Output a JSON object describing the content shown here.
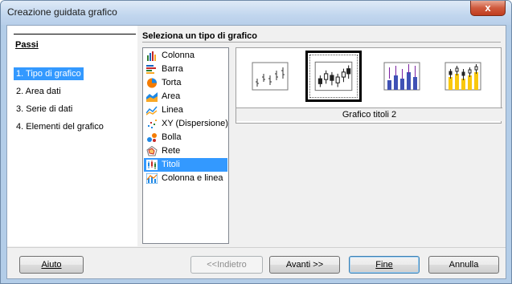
{
  "window": {
    "title": "Creazione guidata grafico",
    "close_symbol": "x"
  },
  "steps": {
    "header": "Passi",
    "items": [
      "1. Tipo di grafico",
      "2. Area dati",
      "3. Serie di dati",
      "4. Elementi del grafico"
    ],
    "active_index": 0
  },
  "chart_type": {
    "section_title": "Seleziona un tipo di grafico",
    "items": [
      {
        "label": "Colonna",
        "icon": "column-chart-icon"
      },
      {
        "label": "Barra",
        "icon": "bar-chart-icon"
      },
      {
        "label": "Torta",
        "icon": "pie-chart-icon"
      },
      {
        "label": "Area",
        "icon": "area-chart-icon"
      },
      {
        "label": "Linea",
        "icon": "line-chart-icon"
      },
      {
        "label": "XY (Dispersione)",
        "icon": "scatter-chart-icon"
      },
      {
        "label": "Bolla",
        "icon": "bubble-chart-icon"
      },
      {
        "label": "Rete",
        "icon": "net-chart-icon"
      },
      {
        "label": "Titoli",
        "icon": "stock-chart-icon"
      },
      {
        "label": "Colonna e linea",
        "icon": "column-line-chart-icon"
      }
    ],
    "selected": "Titoli"
  },
  "variants": {
    "items": [
      "stock-variant-1-icon",
      "stock-variant-2-icon",
      "stock-variant-3-icon",
      "stock-variant-4-icon"
    ],
    "selected_index": 1,
    "caption": "Grafico titoli 2"
  },
  "buttons": {
    "help": "Aiuto",
    "back": "<<Indietro",
    "next": "Avanti >>",
    "finish": "Fine",
    "cancel": "Annulla"
  },
  "colors": {
    "selection": "#3399ff",
    "title_bar": "#c1d6ee",
    "close_button": "#cf5a3d"
  }
}
